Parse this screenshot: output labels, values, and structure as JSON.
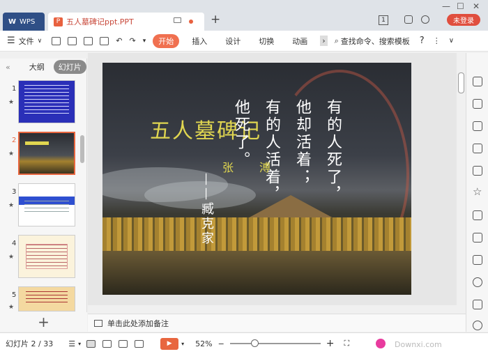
{
  "app": {
    "wps_label": "WPS",
    "doc_title": "五人墓碑记ppt.PPT",
    "new_tab": "+",
    "badge_num": "1",
    "login": "未登录"
  },
  "window": {
    "min": "—",
    "restore": "☐",
    "close": "✕"
  },
  "toolbar": {
    "file": "文件",
    "menu_icon": "☰",
    "tabs": [
      "开始",
      "插入",
      "设计",
      "切换",
      "动画"
    ],
    "active_tab": "开始",
    "more": "›",
    "search": "查找命令、搜索模板",
    "help": "?",
    "more_dots": "⋮",
    "collapse": "∨"
  },
  "left_panel": {
    "collapse": "«",
    "tab_outline": "大纲",
    "tab_slides": "幻灯片",
    "active": "幻灯片",
    "add": "+",
    "slides": [
      {
        "num": "1",
        "star": "★"
      },
      {
        "num": "2",
        "star": "★"
      },
      {
        "num": "3",
        "star": "★"
      },
      {
        "num": "4",
        "star": "★"
      },
      {
        "num": "5",
        "star": "★"
      }
    ],
    "selected": "2"
  },
  "slide": {
    "title": "五人墓碑记",
    "lines": [
      "有的人死了，",
      "他却活着；",
      "有的人活着，",
      "他死了。"
    ],
    "authors": [
      "张",
      "溥"
    ],
    "signature": "——臧克家"
  },
  "notes": {
    "placeholder": "单击此处添加备注"
  },
  "status": {
    "slide_info": "幻灯片 2 / 33",
    "zoom": "52%",
    "minus": "−",
    "plus": "+",
    "play": "▶",
    "zoom_fraction": 0.25
  },
  "watermark": "Downxi.com"
}
